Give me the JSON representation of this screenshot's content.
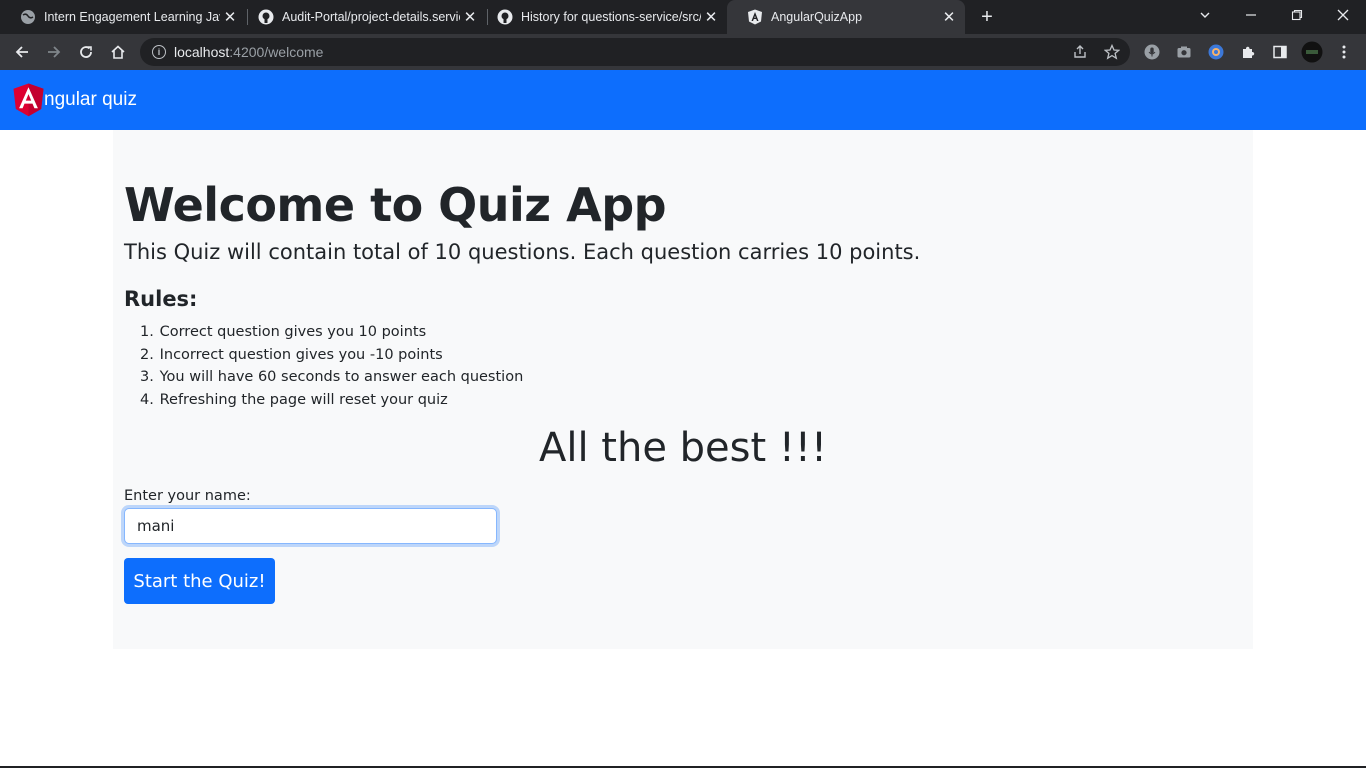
{
  "browser": {
    "tabs": [
      {
        "title": "Intern Engagement Learning Java",
        "icon": "globe-icon"
      },
      {
        "title": "Audit-Portal/project-details.service",
        "icon": "github-icon"
      },
      {
        "title": "History for questions-service/src/",
        "icon": "github-icon"
      },
      {
        "title": "AngularQuizApp",
        "icon": "angular-icon",
        "active": true
      }
    ],
    "close_glyph": "✕",
    "new_tab_glyph": "+",
    "url": {
      "host": "localhost",
      "rest": ":4200/welcome"
    }
  },
  "navbar": {
    "brand_text": "ngular quiz",
    "brand_color": "#0d6efd"
  },
  "welcome": {
    "title": "Welcome to Quiz App",
    "lead": "This Quiz will contain total of 10 questions. Each question carries 10 points.",
    "rules_title": "Rules:",
    "rules": [
      {
        "num": "1.",
        "text": "Correct question gives you 10 points"
      },
      {
        "num": "2.",
        "text": "Incorrect question gives you -10 points"
      },
      {
        "num": "3.",
        "text": "You will have 60 seconds to answer each question"
      },
      {
        "num": "4.",
        "text": "Refreshing the page will reset your quiz"
      }
    ],
    "best": "All the best !!!",
    "name_label": "Enter your name:",
    "name_value": "mani",
    "start_label": "Start the Quiz!"
  }
}
